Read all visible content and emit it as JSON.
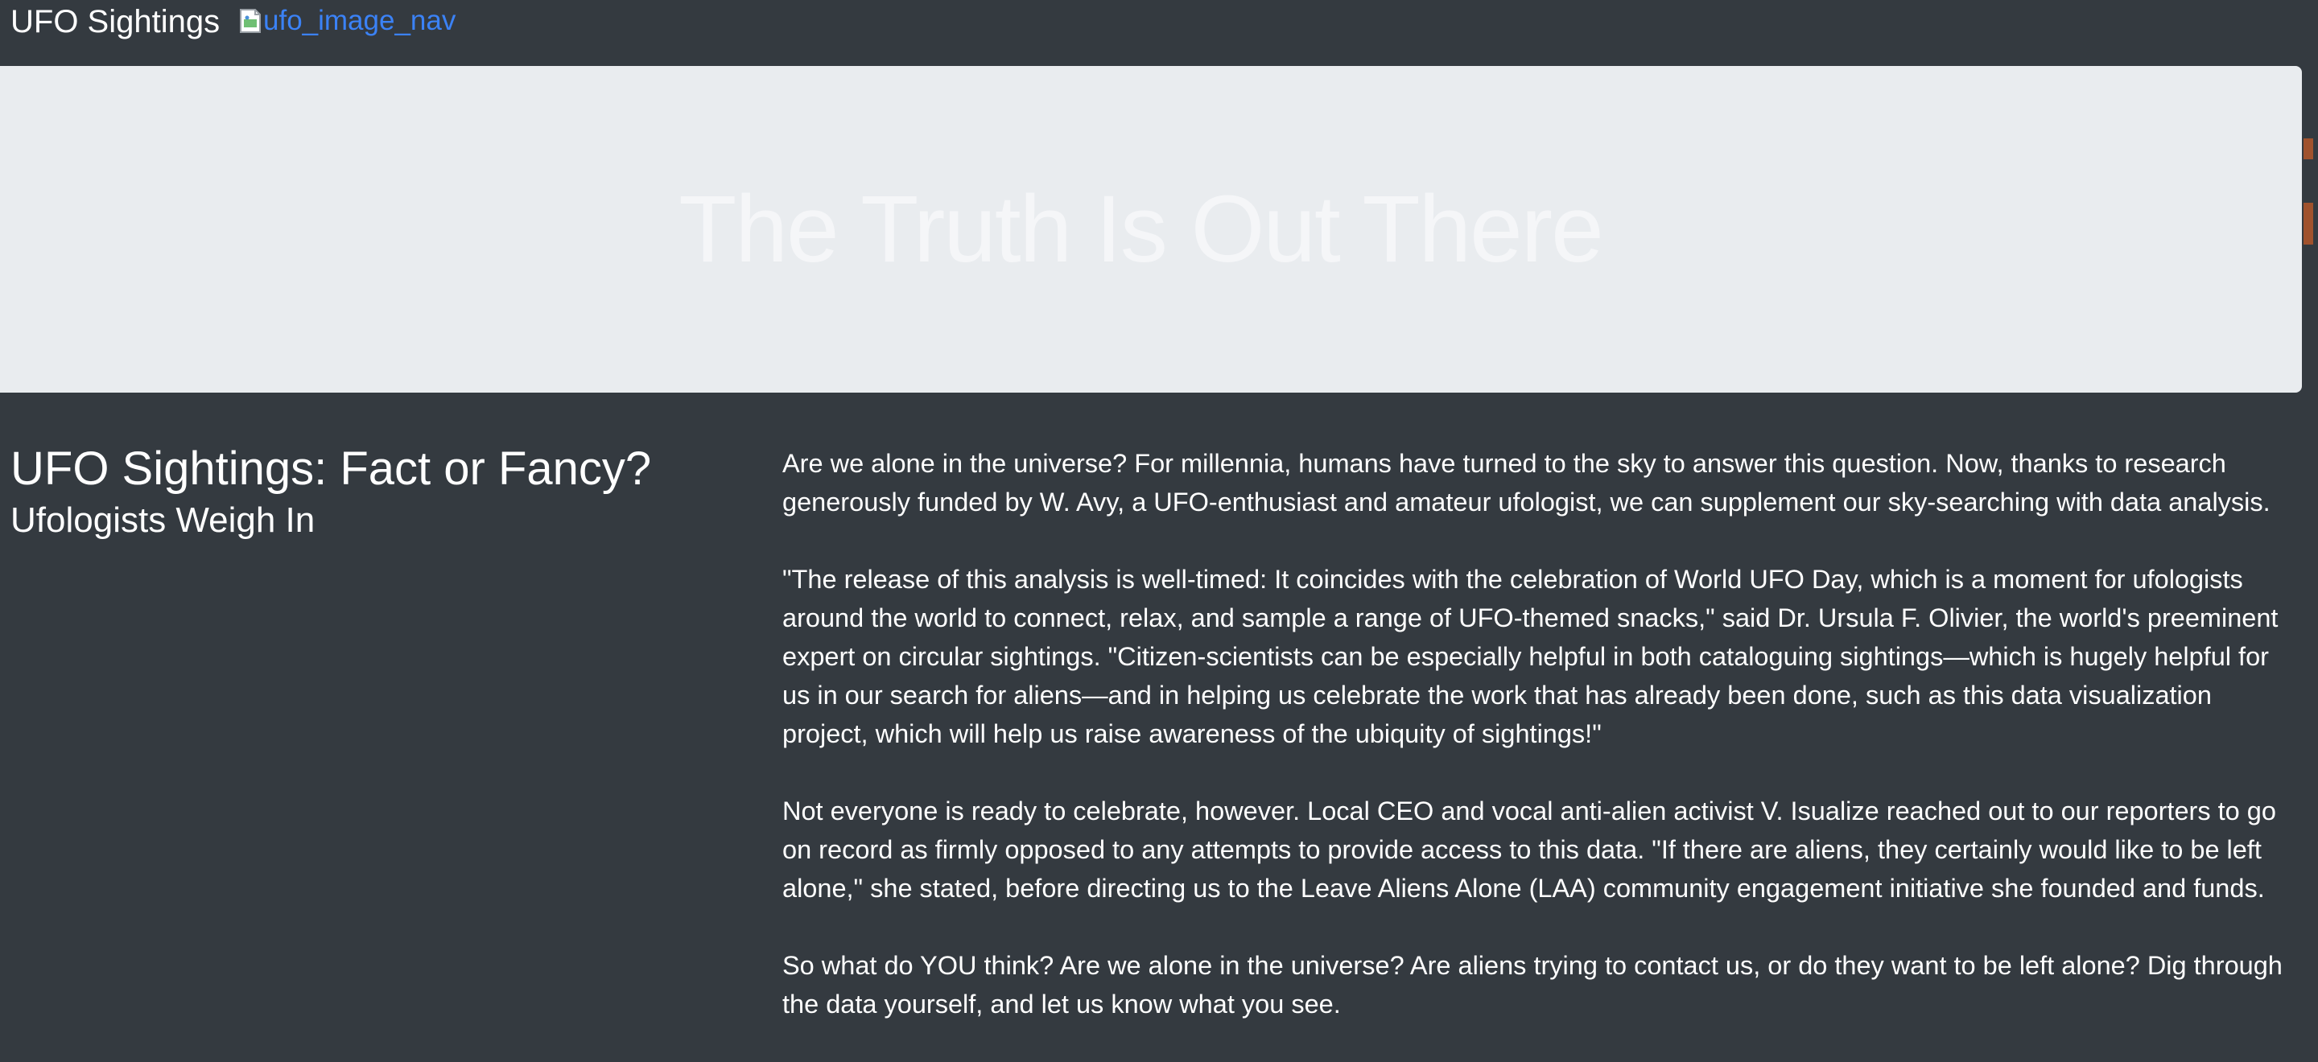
{
  "navbar": {
    "brand": "UFO Sightings",
    "image_alt": "ufo_image_nav"
  },
  "jumbotron": {
    "title": "The Truth Is Out There"
  },
  "article": {
    "heading": "UFO Sightings: Fact or Fancy?",
    "subheading": "Ufologists Weigh In",
    "paragraphs": [
      "Are we alone in the universe? For millennia, humans have turned to the sky to answer this question. Now, thanks to research generously funded by W. Avy, a UFO-enthusiast and amateur ufologist, we can supplement our sky-searching with data analysis.",
      "\"The release of this analysis is well-timed: It coincides with the celebration of World UFO Day, which is a moment for ufologists around the world to connect, relax, and sample a range of UFO-themed snacks,\" said Dr. Ursula F. Olivier, the world's preeminent expert on circular sightings. \"Citizen-scientists can be especially helpful in both cataloguing sightings—which is hugely helpful for us in our search for aliens—and in helping us celebrate the work that has already been done, such as this data visualization project, which will help us raise awareness of the ubiquity of sightings!\"",
      "Not everyone is ready to celebrate, however. Local CEO and vocal anti-alien activist V. Isualize reached out to our reporters to go on record as firmly opposed to any attempts to provide access to this data. \"If there are aliens, they certainly would like to be left alone,\" she stated, before directing us to the Leave Aliens Alone (LAA) community engagement initiative she founded and funds.",
      "So what do YOU think? Are we alone in the universe? Are aliens trying to contact us, or do they want to be left alone? Dig through the data yourself, and let us know what you see."
    ]
  },
  "colors": {
    "page_background": "#343a40",
    "jumbotron_background": "#e9ecef",
    "link": "#3b82f6",
    "text": "#ffffff"
  },
  "icons": {
    "broken_image": "broken-image-icon"
  }
}
